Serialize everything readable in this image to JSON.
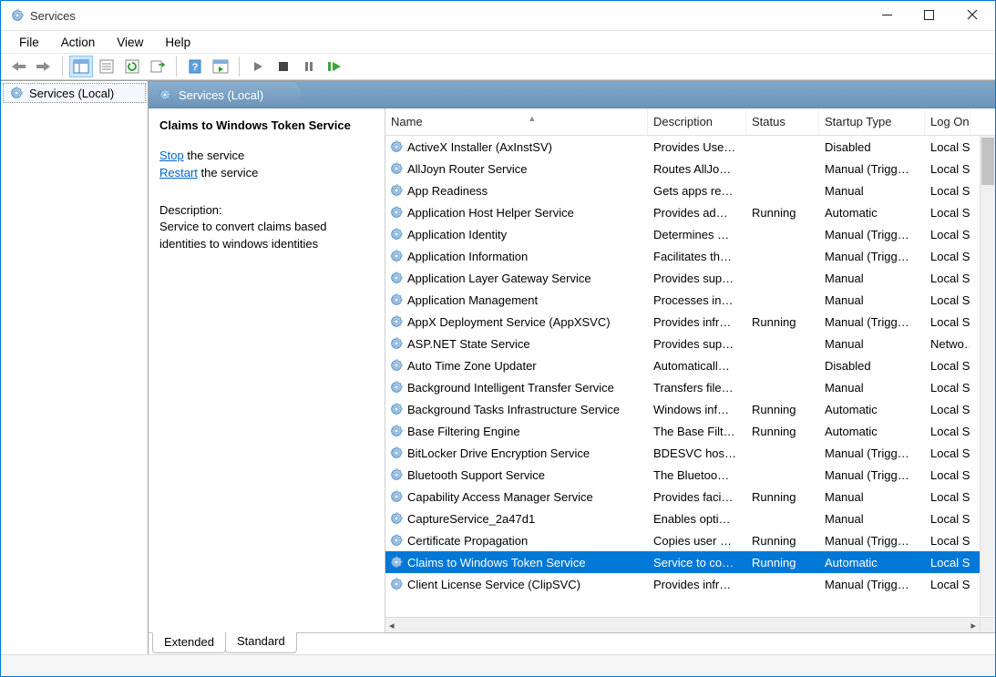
{
  "window": {
    "title": "Services"
  },
  "menubar": [
    "File",
    "Action",
    "View",
    "Help"
  ],
  "tree": {
    "root": "Services (Local)"
  },
  "pane_tab": "Services (Local)",
  "detail": {
    "selected_name": "Claims to Windows Token Service",
    "stop_link": "Stop",
    "stop_suffix": " the service",
    "restart_link": "Restart",
    "restart_suffix": " the service",
    "desc_label": "Description:",
    "desc_text": "Service to convert claims based identities to windows identities"
  },
  "columns": {
    "name": "Name",
    "description": "Description",
    "status": "Status",
    "startup": "Startup Type",
    "logon": "Log On As"
  },
  "services": [
    {
      "name": "ActiveX Installer (AxInstSV)",
      "desc": "Provides Use…",
      "status": "",
      "startup": "Disabled",
      "logon": "Local S…"
    },
    {
      "name": "AllJoyn Router Service",
      "desc": "Routes AllJo…",
      "status": "",
      "startup": "Manual (Trigg…",
      "logon": "Local S…"
    },
    {
      "name": "App Readiness",
      "desc": "Gets apps re…",
      "status": "",
      "startup": "Manual",
      "logon": "Local S…"
    },
    {
      "name": "Application Host Helper Service",
      "desc": "Provides ad…",
      "status": "Running",
      "startup": "Automatic",
      "logon": "Local S…"
    },
    {
      "name": "Application Identity",
      "desc": "Determines …",
      "status": "",
      "startup": "Manual (Trigg…",
      "logon": "Local S…"
    },
    {
      "name": "Application Information",
      "desc": "Facilitates th…",
      "status": "",
      "startup": "Manual (Trigg…",
      "logon": "Local S…"
    },
    {
      "name": "Application Layer Gateway Service",
      "desc": "Provides sup…",
      "status": "",
      "startup": "Manual",
      "logon": "Local S…"
    },
    {
      "name": "Application Management",
      "desc": "Processes in…",
      "status": "",
      "startup": "Manual",
      "logon": "Local S…"
    },
    {
      "name": "AppX Deployment Service (AppXSVC)",
      "desc": "Provides infr…",
      "status": "Running",
      "startup": "Manual (Trigg…",
      "logon": "Local S…"
    },
    {
      "name": "ASP.NET State Service",
      "desc": "Provides sup…",
      "status": "",
      "startup": "Manual",
      "logon": "Netwo…"
    },
    {
      "name": "Auto Time Zone Updater",
      "desc": "Automaticall…",
      "status": "",
      "startup": "Disabled",
      "logon": "Local S…"
    },
    {
      "name": "Background Intelligent Transfer Service",
      "desc": "Transfers file…",
      "status": "",
      "startup": "Manual",
      "logon": "Local S…"
    },
    {
      "name": "Background Tasks Infrastructure Service",
      "desc": "Windows inf…",
      "status": "Running",
      "startup": "Automatic",
      "logon": "Local S…"
    },
    {
      "name": "Base Filtering Engine",
      "desc": "The Base Filt…",
      "status": "Running",
      "startup": "Automatic",
      "logon": "Local S…"
    },
    {
      "name": "BitLocker Drive Encryption Service",
      "desc": "BDESVC hos…",
      "status": "",
      "startup": "Manual (Trigg…",
      "logon": "Local S…"
    },
    {
      "name": "Bluetooth Support Service",
      "desc": "The Bluetoo…",
      "status": "",
      "startup": "Manual (Trigg…",
      "logon": "Local S…"
    },
    {
      "name": "Capability Access Manager Service",
      "desc": "Provides faci…",
      "status": "Running",
      "startup": "Manual",
      "logon": "Local S…"
    },
    {
      "name": "CaptureService_2a47d1",
      "desc": "Enables opti…",
      "status": "",
      "startup": "Manual",
      "logon": "Local S…"
    },
    {
      "name": "Certificate Propagation",
      "desc": "Copies user …",
      "status": "Running",
      "startup": "Manual (Trigg…",
      "logon": "Local S…"
    },
    {
      "name": "Claims to Windows Token Service",
      "desc": "Service to co…",
      "status": "Running",
      "startup": "Automatic",
      "logon": "Local S…",
      "selected": true
    },
    {
      "name": "Client License Service (ClipSVC)",
      "desc": "Provides infr…",
      "status": "",
      "startup": "Manual (Trigg…",
      "logon": "Local S…"
    }
  ],
  "bottom_tabs": {
    "extended": "Extended",
    "standard": "Standard"
  }
}
